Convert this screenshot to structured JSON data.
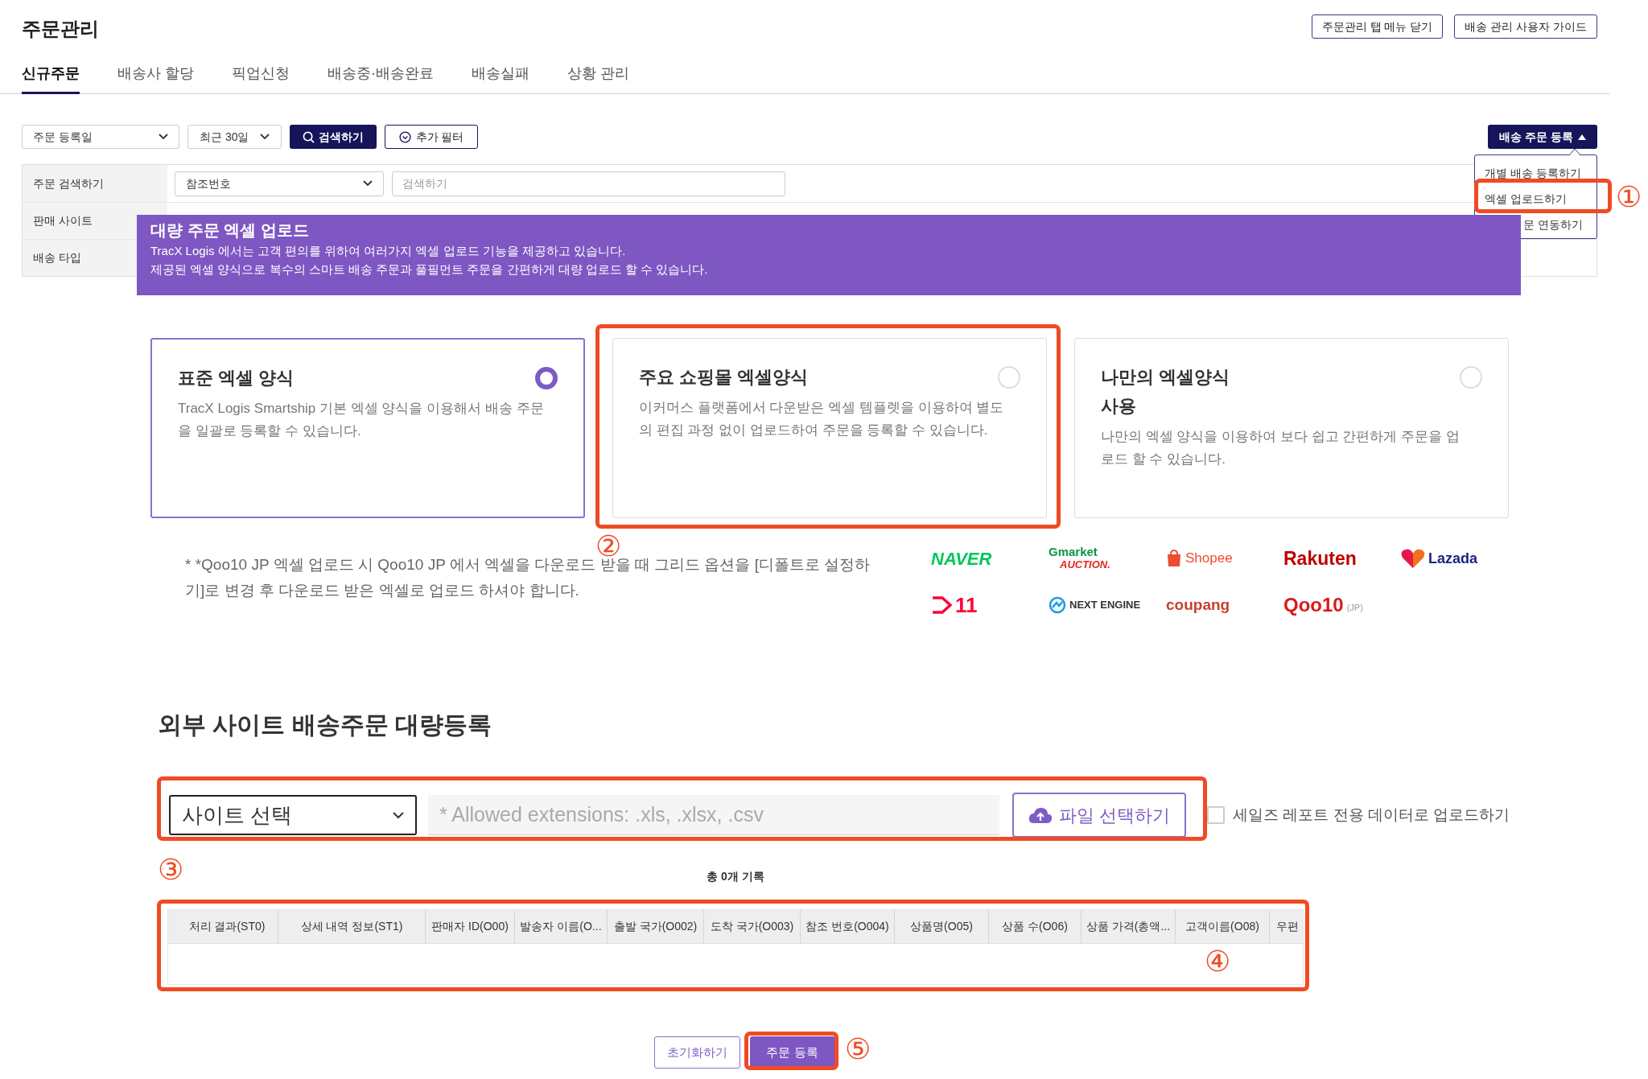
{
  "page_title": "주문관리",
  "header_buttons": [
    "주문관리 탭 메뉴 닫기",
    "배송 관리 사용자 가이드"
  ],
  "tabs": [
    {
      "label": "신규주문",
      "selected": true
    },
    {
      "label": "배송사 할당",
      "selected": false
    },
    {
      "label": "픽업신청",
      "selected": false
    },
    {
      "label": "배송중·배송완료",
      "selected": false
    },
    {
      "label": "배송실패",
      "selected": false
    },
    {
      "label": "상황 관리",
      "selected": false
    }
  ],
  "filters": {
    "date_type": "주문 등록일",
    "period": "최근 30일",
    "search_button": "검색하기",
    "filter_button": "추가 필터"
  },
  "register_button": "배송 주문 등록",
  "register_menu": [
    {
      "label": "개별 배송 등록하기"
    },
    {
      "label": "엑셀 업로드하기"
    },
    {
      "label": "문 연동하기"
    }
  ],
  "search_panel": [
    {
      "label": "주문 검색하기",
      "kind": "search",
      "select": "참조번호",
      "placeholder": "검색하기"
    },
    {
      "label": "판매 사이트",
      "kind": "plain"
    },
    {
      "label": "배송 타입",
      "kind": "plain"
    }
  ],
  "banner": {
    "title": "대량 주문 엑셀 업로드",
    "lines": [
      "TracX Logis 에서는 고객 편의를 위하여 여러가지 엑셀 업로드 기능을 제공하고 있습니다.",
      "제공된 엑셀 양식으로 복수의 스마트 배송 주문과 풀필먼트 주문을 간편하게 대량 업로드 할 수 있습니다."
    ]
  },
  "templates": [
    {
      "title": "표준 엑셀 양식",
      "description": "TracX Logis Smartship 기본 엑셀 양식을 이용해서 배송 주문을 일괄로 등록할 수 있습니다.",
      "selected": true
    },
    {
      "title": "주요 쇼핑몰 엑셀양식",
      "description": "이커머스 플랫폼에서 다운받은 엑셀 템플렛을 이용하여 별도의 편집 과정 없이 업로드하여 주문을 등록할 수 있습니다.",
      "selected": false
    },
    {
      "title": "나만의 엑셀양식\n사용",
      "description": "나만의 엑셀 양식을 이용하여 보다 쉽고 간편하게 주문을 업로드 할 수 있습니다.",
      "selected": false
    }
  ],
  "note": "* *Qoo10 JP 엑셀 업로드 시 Qoo10 JP 에서 엑셀을 다운로드 받을 때 그리드 옵션을 [디폴트로 설정하기]로 변경 후 다운로드 받은 엑셀로 업로드 하셔야 합니다.",
  "marketplaces": [
    {
      "text": "NAVER",
      "color": "#03c75a"
    },
    {
      "text": "Gmarket",
      "subtext": "AUCTION.",
      "color": "#0b9444"
    },
    {
      "text": "Shopee",
      "color": "#ee4d2d"
    },
    {
      "text": "Rakuten",
      "color": "#bf0000"
    },
    {
      "text": "Lazada",
      "color": "#1a237e"
    },
    {
      "text": "11",
      "color": "#ff0038"
    },
    {
      "text": "NEXT ENGINE",
      "color": "#333333"
    },
    {
      "text": "coupang",
      "color": "#c7402d"
    },
    {
      "text": "Qoo10",
      "subtext": "(JP)",
      "color": "#d81b1b"
    }
  ],
  "bulk": {
    "heading": "외부 사이트 배송주문 대량등록",
    "site_select": "사이트 선택",
    "file_placeholder": "* Allowed extensions: .xls, .xlsx, .csv",
    "file_button": "파일 선택하기",
    "sales_report": {
      "label": "세일즈 레포트 전용 데이터로 업로드하기",
      "checked": false
    },
    "record_count": "총 0개 기록",
    "columns": [
      "처리 결과(ST0)",
      "상세 내역 정보(ST1)",
      "판매자 ID(O00)",
      "발송자 이름(O...",
      "출발 국가(O002)",
      "도착 국가(O003)",
      "참조 번호(O004)",
      "상품명(O05)",
      "상품 수(O06)",
      "상품 가격(총액...",
      "고객이름(O08)",
      "우편"
    ]
  },
  "actions": {
    "reset": "초기화하기",
    "submit": "주문 등록"
  },
  "annotations": [
    {
      "label": "①"
    },
    {
      "label": "②"
    },
    {
      "label": "③"
    },
    {
      "label": "④"
    },
    {
      "label": "⑤"
    }
  ]
}
